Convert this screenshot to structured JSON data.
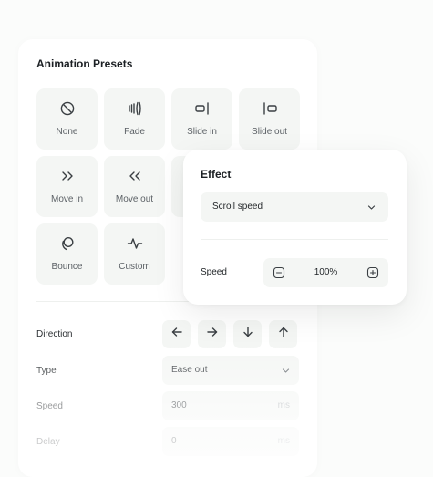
{
  "animation_presets": {
    "title": "Animation Presets",
    "presets": [
      {
        "label": "None",
        "icon": "no-entry-icon"
      },
      {
        "label": "Fade",
        "icon": "fade-icon"
      },
      {
        "label": "Slide in",
        "icon": "slide-in-icon"
      },
      {
        "label": "Slide out",
        "icon": "slide-out-icon"
      },
      {
        "label": "Move in",
        "icon": "move-in-icon"
      },
      {
        "label": "Move out",
        "icon": "move-out-icon"
      },
      {
        "label": "Bounce",
        "icon": "bounce-icon"
      },
      {
        "label": "Custom",
        "icon": "custom-pulse-icon"
      }
    ],
    "direction": {
      "label": "Direction",
      "buttons": [
        "arrow-left-icon",
        "arrow-right-icon",
        "arrow-down-icon",
        "arrow-up-icon"
      ]
    },
    "type": {
      "label": "Type",
      "value": "Ease out"
    },
    "speed": {
      "label": "Speed",
      "value": "300",
      "unit": "ms"
    },
    "delay": {
      "label": "Delay",
      "value": "0",
      "unit": "ms"
    }
  },
  "effect": {
    "title": "Effect",
    "select_value": "Scroll speed",
    "speed_label": "Speed",
    "speed_value": "100%"
  },
  "colors": {
    "background": "#fbfcfb",
    "card": "#ffffff",
    "tile": "#f4f6f4",
    "text": "#1f2326",
    "muted": "#5c6166"
  }
}
